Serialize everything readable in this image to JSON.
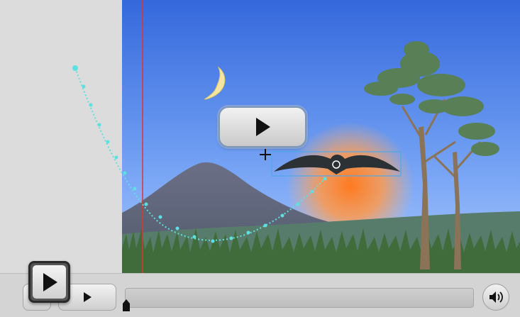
{
  "app": {
    "kind": "animation-timeline-editor"
  },
  "colors": {
    "sky_top": "#3a6fe0",
    "sky_bottom": "#9cc4ff",
    "sun_glow": "#ff8c3a",
    "mountain": "#5e6b7d",
    "hill": "#5a7f6e",
    "grass": "#3f6a38",
    "moon": "#f2e39a",
    "bird": "#2c3135",
    "motion_path": "#5fe0e0",
    "playhead_line": "#d23a3a",
    "selection_box": "#4fa8e8"
  },
  "canvas": {
    "scene_elements": [
      "sky",
      "moon",
      "sun",
      "mountain",
      "hill",
      "grass",
      "trees",
      "bird"
    ],
    "selected_object": "bird",
    "motion_path_visible": true
  },
  "overlay_play_button": {
    "icon": "play-icon"
  },
  "controls": {
    "play_icon": "play-icon",
    "floating_play_icon": "play-icon",
    "volume_icon": "speaker-icon",
    "playback_progress": 0.0
  }
}
